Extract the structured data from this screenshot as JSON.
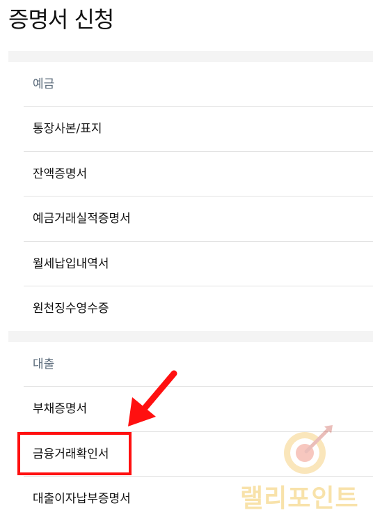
{
  "page_title": "증명서 신청",
  "sections": [
    {
      "header": "예금",
      "items": [
        "통장사본/표지",
        "잔액증명서",
        "예금거래실적증명서",
        "월세납입내역서",
        "원천징수영수증"
      ]
    },
    {
      "header": "대출",
      "items": [
        "부채증명서",
        "금융거래확인서",
        "대출이자납부증명서"
      ]
    }
  ],
  "annotation": {
    "highlight_color": "#ff1010",
    "arrow_color": "#ff1010"
  },
  "watermark": {
    "text": "랠리포인트",
    "color": "#f6d98e",
    "icon": "target-arrow-icon"
  }
}
